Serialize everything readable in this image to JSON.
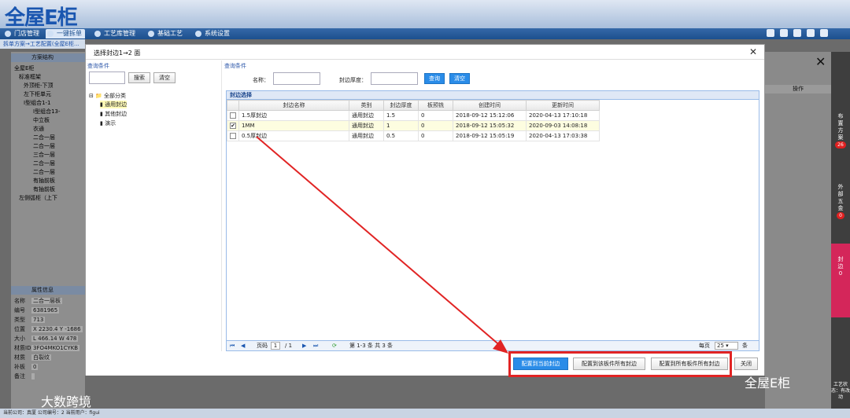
{
  "app": {
    "logo": "全屋E柜"
  },
  "menu": [
    "门店管理",
    "一键拆单",
    "工艺库管理",
    "基础工艺",
    "系统设置"
  ],
  "breadcrumb": "拆单方案→工艺配置(全屋E柜...",
  "left": {
    "header": "方案结构",
    "tree": [
      "全屋E柜",
      "标准框架",
      "外顶柜-下顶",
      "左下柜单元",
      "I型组合1-1",
      "I型组合13-",
      "中立板",
      "衣通",
      "二合一层",
      "二合一层",
      "三合一层",
      "二合一层",
      "二合一层",
      "有抽前板",
      "有抽前板",
      "左侧弧柜（上下"
    ],
    "props_header": "属性信息",
    "props": [
      [
        "名称",
        "二合一层板"
      ],
      [
        "编号",
        "6381965"
      ],
      [
        "类型",
        "713"
      ],
      [
        "位置",
        "X 2230.4  Y -1686"
      ],
      [
        "大小",
        "L 466.14  W 478"
      ],
      [
        "材质ID",
        "3FO4MKO1CYKB"
      ],
      [
        "材质",
        "白裂纹"
      ],
      [
        "补板",
        "0"
      ],
      [
        "备注",
        ""
      ]
    ]
  },
  "dialog": {
    "title": "选择封边1→2 面",
    "left_hint": "查询条件",
    "search": "搜索",
    "clear": "清空",
    "tree_root": "全部分类",
    "tree_items": [
      "通用封边",
      "其他封边",
      "演示"
    ],
    "right_hint": "查询条件",
    "name_label": "名称：",
    "thick_label": "封边厚度：",
    "query": "查询",
    "clear2": "清空",
    "grid_title": "封边选择",
    "columns": [
      "封边名称",
      "类别",
      "封边厚度",
      "板预铣",
      "创建时间",
      "更新时间"
    ],
    "rows": [
      {
        "name": "1.5厚封边",
        "cat": "通用封边",
        "thick": "1.5",
        "mill": "0",
        "created": "2018-09-12 15:12:06",
        "updated": "2020-04-13 17:10:18",
        "checked": false
      },
      {
        "name": "1MM",
        "cat": "通用封边",
        "thick": "1",
        "mill": "0",
        "created": "2018-09-12 15:05:32",
        "updated": "2020-09-03 14:08:18",
        "checked": true
      },
      {
        "name": "0.5厚封边",
        "cat": "通用封边",
        "thick": "0.5",
        "mill": "0",
        "created": "2018-09-12 15:05:19",
        "updated": "2020-04-13 17:03:38",
        "checked": false
      }
    ],
    "pager": {
      "page_label": "页码",
      "page": "1",
      "total": "/ 1",
      "summary": "第 1-3 条  共 3 条",
      "per_page_label": "每页",
      "per_page": "25",
      "unit": "条"
    },
    "buttons": [
      "配置到当前封边",
      "配置到该板件所有封边",
      "配置到所有板件所有封边",
      "关闭"
    ]
  },
  "right": {
    "header": "操作"
  },
  "sidebar": [
    {
      "label": "布置方案",
      "badge": "26"
    },
    {
      "label": "外部五金",
      "badge": "0"
    },
    {
      "label": "封边",
      "badge": "0"
    }
  ],
  "sidebar_note": "工艺状态：有改动",
  "status": "当前公司：真厦   公司编号：2   当前用户：figui",
  "watermarks": [
    "大数跨境",
    "全屋E柜"
  ]
}
